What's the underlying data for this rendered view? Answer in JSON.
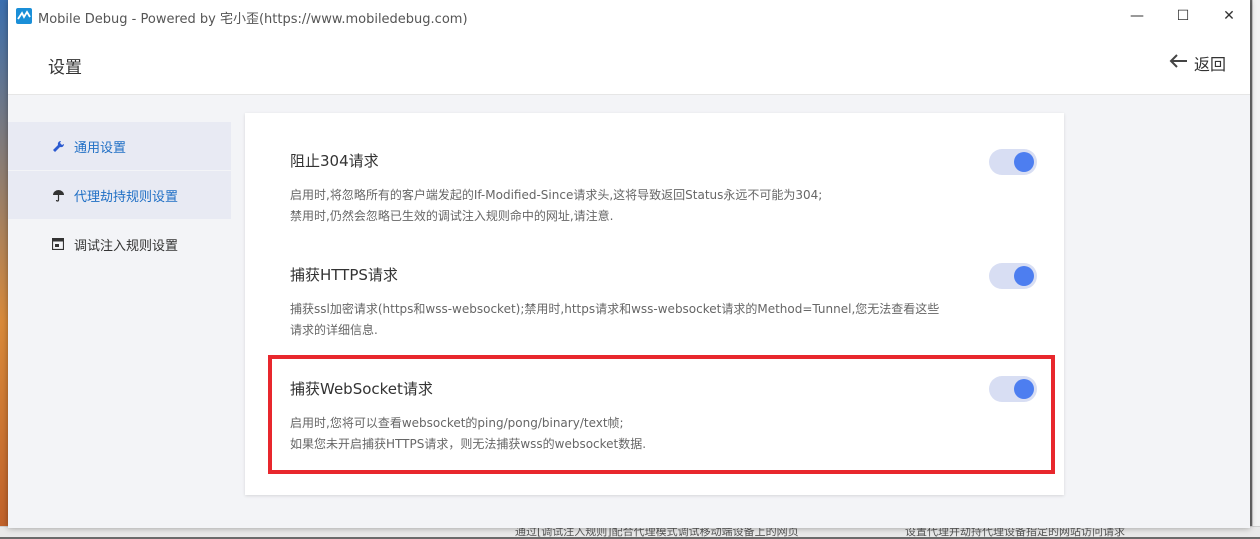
{
  "window": {
    "title": "Mobile Debug - Powered by 宅小歪(https://www.mobiledebug.com)",
    "controls": {
      "minimize": "—",
      "maximize": "☐",
      "close": "✕"
    }
  },
  "header": {
    "title": "设置",
    "back_label": "返回"
  },
  "sidebar": {
    "items": [
      {
        "label": "通用设置",
        "icon": "wrench-icon"
      },
      {
        "label": "代理劫持规则设置",
        "icon": "umbrella-icon"
      },
      {
        "label": "调试注入规则设置",
        "icon": "window-icon"
      }
    ]
  },
  "settings": [
    {
      "title": "阻止304请求",
      "desc_line1": "启用时,将忽略所有的客户端发起的If-Modified-Since请求头,这将导致返回Status永远不可能为304;",
      "desc_line2": "禁用时,仍然会忽略已生效的调试注入规则命中的网址,请注意.",
      "enabled": true
    },
    {
      "title": "捕获HTTPS请求",
      "desc_line1": "捕获ssl加密请求(https和wss-websocket);禁用时,https请求和wss-websocket请求的Method=Tunnel,您无法查看这些请求的详细信息.",
      "enabled": true
    },
    {
      "title": "捕获WebSocket请求",
      "desc_line1": "启用时,您将可以查看websocket的ping/pong/binary/text帧;",
      "desc_line2": "如果您未开启捕获HTTPS请求，则无法捕获wss的websocket数据.",
      "enabled": true
    }
  ],
  "background_text": {
    "left": "通过[调试注入规则]配合代理模式调试移动端设备上的网页",
    "right": "设置代理并劫持代理设备指定的网站访问请求"
  },
  "colors": {
    "accent": "#4d7ef0",
    "toggle_track": "#d8def3",
    "highlight": "#e8272d",
    "link": "#1f6fc5"
  }
}
